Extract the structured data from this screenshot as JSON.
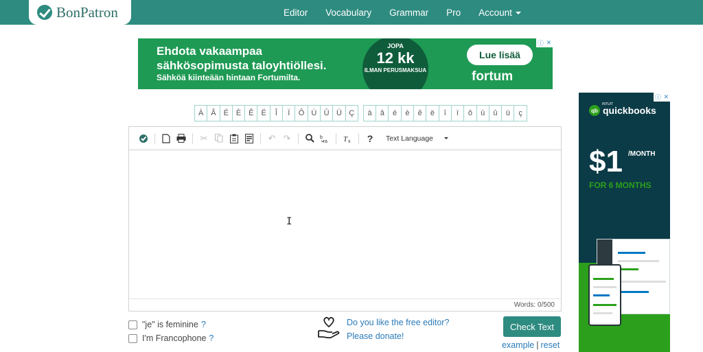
{
  "app": {
    "logo_text": "BonPatron",
    "nav": [
      "Editor",
      "Vocabulary",
      "Grammar",
      "Pro",
      "Account"
    ]
  },
  "ad_top": {
    "headline": "Ehdota vakaampaa sähkösopimusta taloyhtiöllesi.",
    "subline": "Sähköä kiinteään hintaan Fortumilta.",
    "circle_top": "JOPA",
    "circle_big": "12 kk",
    "circle_bottom": "ILMAN PERUSMAKSUA",
    "button": "Lue lisää",
    "brand": "fortum"
  },
  "special_chars": {
    "upper": [
      "À",
      "Â",
      "É",
      "È",
      "Ê",
      "Ë",
      "Î",
      "Ï",
      "Ô",
      "Ù",
      "Û",
      "Ü",
      "Ç"
    ],
    "lower": [
      "à",
      "â",
      "é",
      "è",
      "ê",
      "ë",
      "î",
      "ï",
      "ô",
      "ù",
      "û",
      "ü",
      "ç"
    ]
  },
  "toolbar": {
    "language_label": "Text Language"
  },
  "editor": {
    "word_count": "Words: 0/500"
  },
  "options": {
    "feminine_label": "\"je\" is feminine",
    "francophone_label": "I'm Francophone",
    "help": "?"
  },
  "donate": {
    "line1": "Do you like the free editor?",
    "line2": "Please donate!"
  },
  "actions": {
    "check_label": "Check Text",
    "example_label": "example",
    "separator": "|",
    "reset_label": "reset"
  },
  "ad_side": {
    "brand": "quickbooks",
    "intuit": "INTUIT",
    "price": "$1",
    "period": "/MONTH",
    "offer": "FOR 6 MONTHS"
  },
  "colors": {
    "primary": "#2e8b80",
    "link": "#2b7bb9",
    "fortum_green": "#1e9a54",
    "qb_dark": "#0b3b46",
    "qb_green": "#2ca01c"
  }
}
